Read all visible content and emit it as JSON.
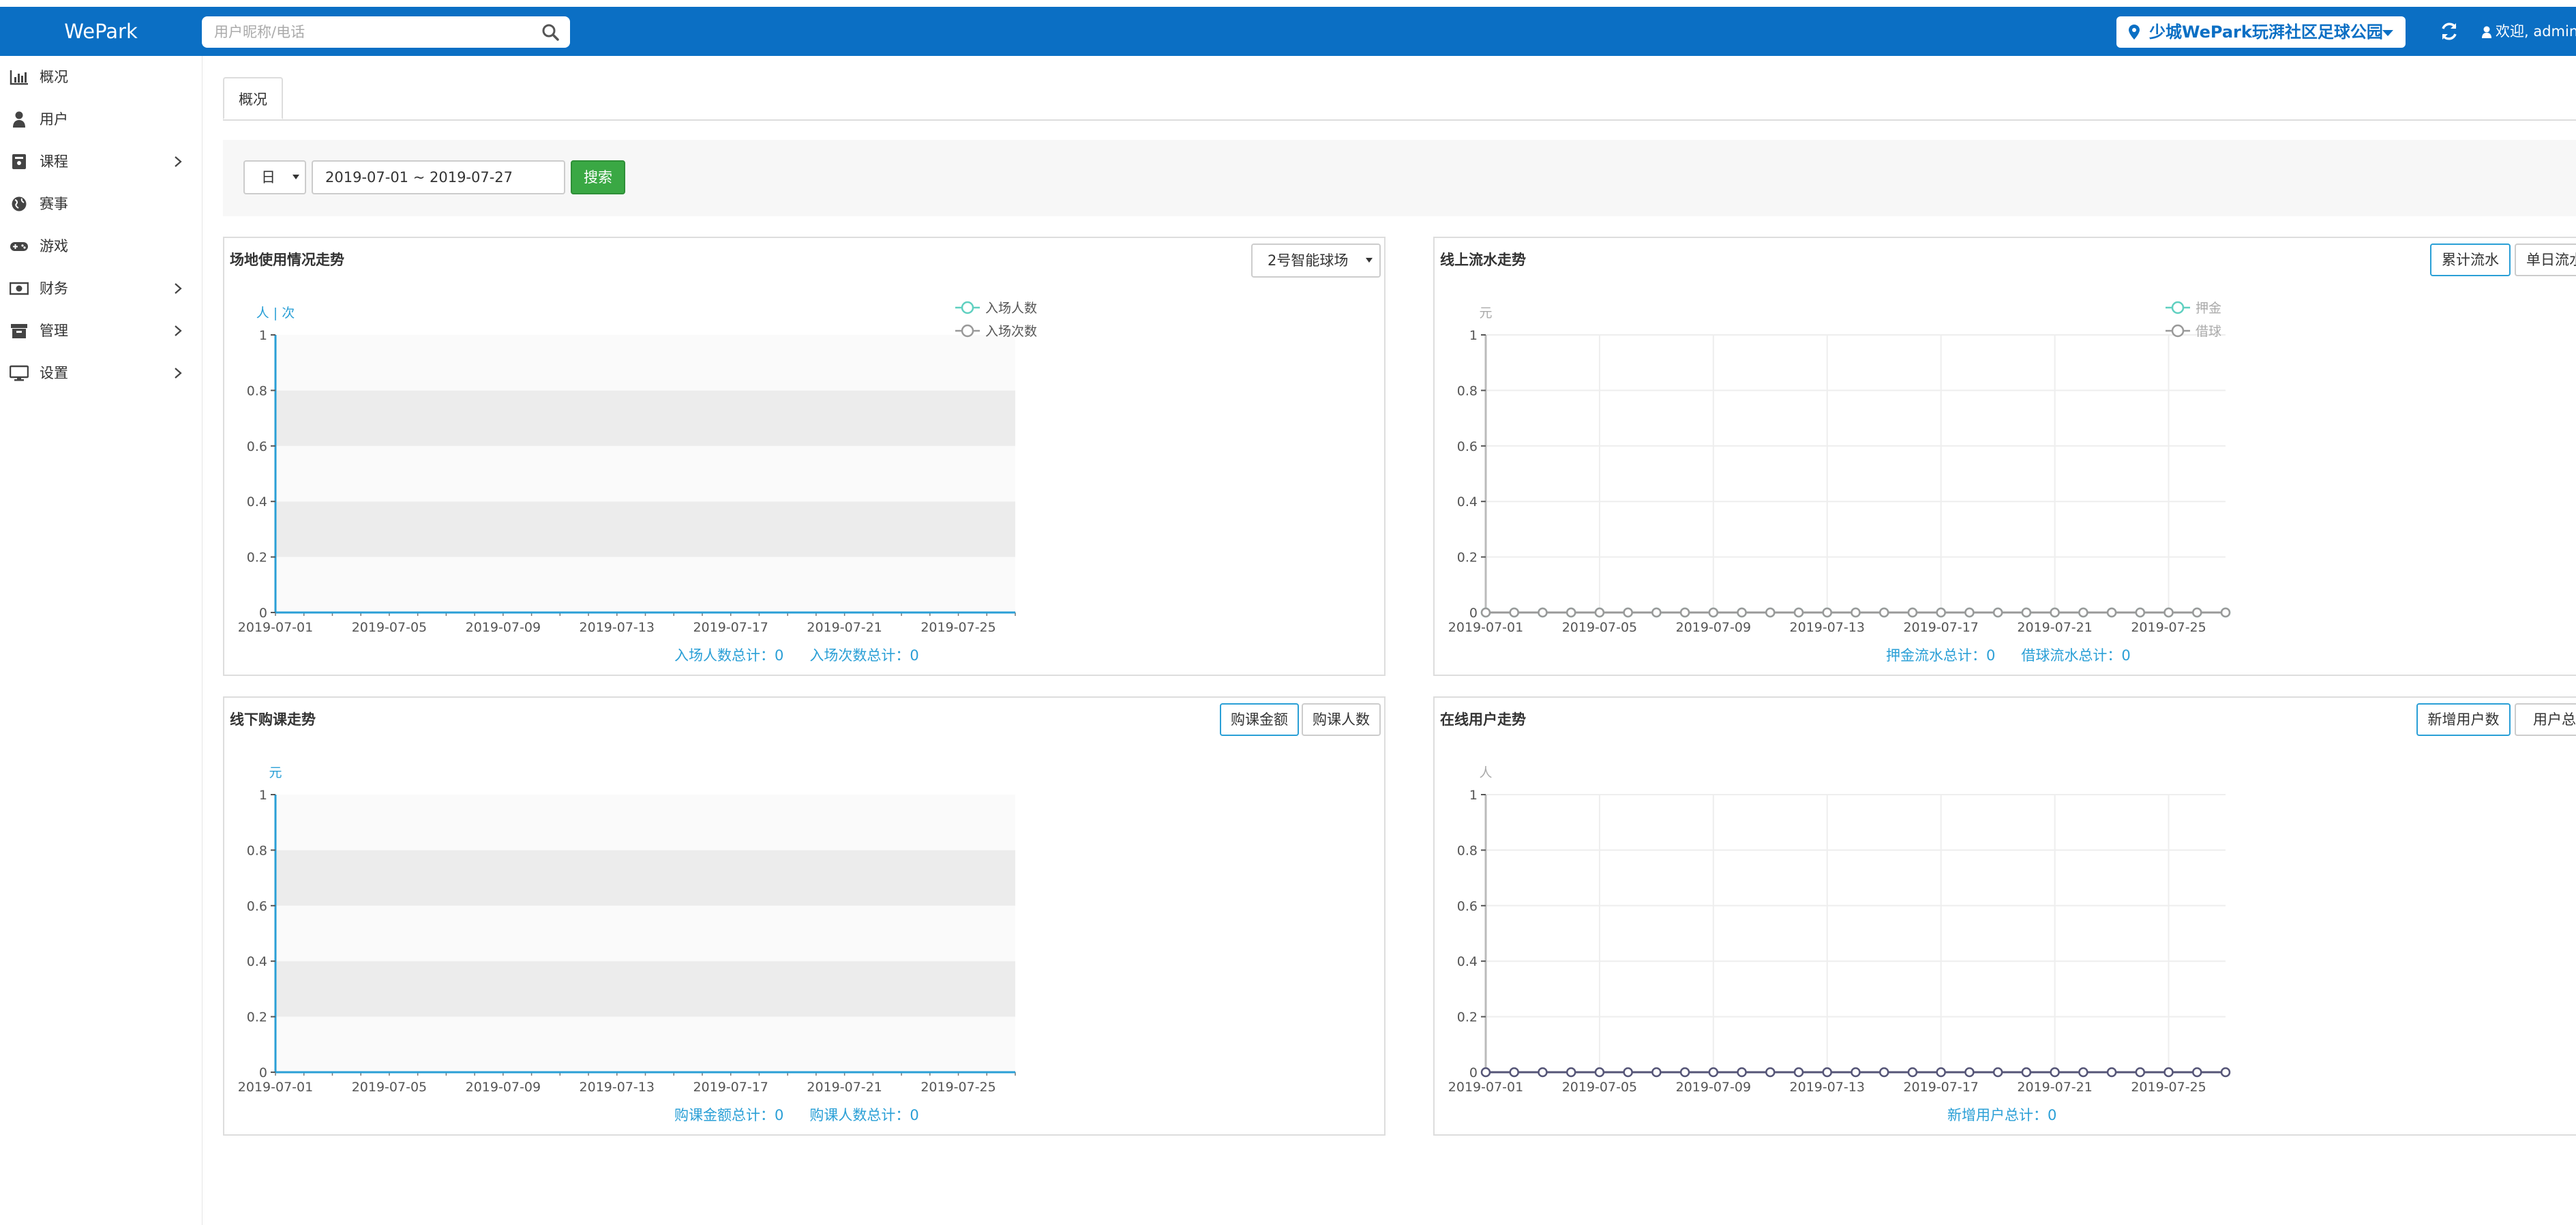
{
  "app": {
    "brand": "WePark"
  },
  "header": {
    "search_placeholder": "用户昵称/电话",
    "venue": "少城WePark玩湃社区足球公园",
    "welcome": "欢迎, admin"
  },
  "sidebar": {
    "items": [
      {
        "label": "概况",
        "icon": "bar-chart-icon",
        "has_submenu": false
      },
      {
        "label": "用户",
        "icon": "user-icon",
        "has_submenu": false
      },
      {
        "label": "课程",
        "icon": "book-icon",
        "has_submenu": true
      },
      {
        "label": "赛事",
        "icon": "globe-icon",
        "has_submenu": false
      },
      {
        "label": "游戏",
        "icon": "gamepad-icon",
        "has_submenu": false
      },
      {
        "label": "财务",
        "icon": "money-icon",
        "has_submenu": true
      },
      {
        "label": "管理",
        "icon": "archive-icon",
        "has_submenu": true
      },
      {
        "label": "设置",
        "icon": "desktop-icon",
        "has_submenu": true
      }
    ]
  },
  "tabs": [
    {
      "label": "概况",
      "active": true
    }
  ],
  "filter": {
    "period": "日",
    "date_range": "2019-07-01 ~ 2019-07-27",
    "search_label": "搜索"
  },
  "colors": {
    "navbar": "#0b6fc4",
    "accent": "#2a9fd6",
    "search_button": "#3aa844",
    "series_teal": "#5fd0c0",
    "series_gray": "#999999",
    "series_dark": "#555577"
  },
  "panels": {
    "venue_usage": {
      "title": "场地使用情况走势",
      "select_value": "2号智能球场",
      "totals": [
        "入场人数总计：0",
        "入场次数总计：0"
      ]
    },
    "online_flow": {
      "title": "线上流水走势",
      "buttons": [
        "累计流水",
        "单日流水"
      ],
      "totals": [
        "押金流水总计：0",
        "借球流水总计：0"
      ]
    },
    "offline_purchase": {
      "title": "线下购课走势",
      "buttons": [
        "购课金额",
        "购课人数"
      ],
      "totals": [
        "购课金额总计：0",
        "购课人数总计：0"
      ]
    },
    "online_users": {
      "title": "在线用户走势",
      "buttons": [
        "新增用户数",
        "用户总数"
      ],
      "totals": [
        "新增用户总计：0"
      ]
    }
  },
  "chart_data": [
    {
      "id": "venue_usage",
      "type": "line",
      "style": "banded",
      "ylabel": "人 | 次",
      "ylim": [
        0,
        1
      ],
      "yticks": [
        "0",
        "0.2",
        "0.4",
        "0.6",
        "0.8",
        "1"
      ],
      "xticks": [
        "2019-07-01",
        "2019-07-05",
        "2019-07-09",
        "2019-07-13",
        "2019-07-17",
        "2019-07-21",
        "2019-07-25"
      ],
      "legend": [
        "入场人数",
        "入场次数"
      ],
      "legend_position": "top-right",
      "x": [
        "2019-07-01",
        "2019-07-02",
        "2019-07-03",
        "2019-07-04",
        "2019-07-05",
        "2019-07-06",
        "2019-07-07",
        "2019-07-08",
        "2019-07-09",
        "2019-07-10",
        "2019-07-11",
        "2019-07-12",
        "2019-07-13",
        "2019-07-14",
        "2019-07-15",
        "2019-07-16",
        "2019-07-17",
        "2019-07-18",
        "2019-07-19",
        "2019-07-20",
        "2019-07-21",
        "2019-07-22",
        "2019-07-23",
        "2019-07-24",
        "2019-07-25",
        "2019-07-26",
        "2019-07-27"
      ],
      "series": [
        {
          "name": "入场人数",
          "values": [
            0,
            0,
            0,
            0,
            0,
            0,
            0,
            0,
            0,
            0,
            0,
            0,
            0,
            0,
            0,
            0,
            0,
            0,
            0,
            0,
            0,
            0,
            0,
            0,
            0,
            0,
            0
          ],
          "markers": false
        },
        {
          "name": "入场次数",
          "values": [
            0,
            0,
            0,
            0,
            0,
            0,
            0,
            0,
            0,
            0,
            0,
            0,
            0,
            0,
            0,
            0,
            0,
            0,
            0,
            0,
            0,
            0,
            0,
            0,
            0,
            0,
            0
          ],
          "markers": false
        }
      ]
    },
    {
      "id": "online_flow",
      "type": "line",
      "style": "grid",
      "ylabel": "元",
      "ylim": [
        0,
        1
      ],
      "yticks": [
        "0",
        "0.2",
        "0.4",
        "0.6",
        "0.8",
        "1"
      ],
      "xticks": [
        "2019-07-01",
        "2019-07-05",
        "2019-07-09",
        "2019-07-13",
        "2019-07-17",
        "2019-07-21",
        "2019-07-25"
      ],
      "legend": [
        "押金",
        "借球"
      ],
      "legend_position": "top-right",
      "x": [
        "2019-07-01",
        "2019-07-02",
        "2019-07-03",
        "2019-07-04",
        "2019-07-05",
        "2019-07-06",
        "2019-07-07",
        "2019-07-08",
        "2019-07-09",
        "2019-07-10",
        "2019-07-11",
        "2019-07-12",
        "2019-07-13",
        "2019-07-14",
        "2019-07-15",
        "2019-07-16",
        "2019-07-17",
        "2019-07-18",
        "2019-07-19",
        "2019-07-20",
        "2019-07-21",
        "2019-07-22",
        "2019-07-23",
        "2019-07-24",
        "2019-07-25",
        "2019-07-26",
        "2019-07-27"
      ],
      "series": [
        {
          "name": "押金",
          "values": [
            0,
            0,
            0,
            0,
            0,
            0,
            0,
            0,
            0,
            0,
            0,
            0,
            0,
            0,
            0,
            0,
            0,
            0,
            0,
            0,
            0,
            0,
            0,
            0,
            0,
            0,
            0
          ],
          "markers": true
        },
        {
          "name": "借球",
          "values": [
            0,
            0,
            0,
            0,
            0,
            0,
            0,
            0,
            0,
            0,
            0,
            0,
            0,
            0,
            0,
            0,
            0,
            0,
            0,
            0,
            0,
            0,
            0,
            0,
            0,
            0,
            0
          ],
          "markers": true
        }
      ]
    },
    {
      "id": "offline_purchase",
      "type": "line",
      "style": "banded",
      "ylabel": "元",
      "ylim": [
        0,
        1
      ],
      "yticks": [
        "0",
        "0.2",
        "0.4",
        "0.6",
        "0.8",
        "1"
      ],
      "xticks": [
        "2019-07-01",
        "2019-07-05",
        "2019-07-09",
        "2019-07-13",
        "2019-07-17",
        "2019-07-21",
        "2019-07-25"
      ],
      "legend": [],
      "x": [
        "2019-07-01",
        "2019-07-02",
        "2019-07-03",
        "2019-07-04",
        "2019-07-05",
        "2019-07-06",
        "2019-07-07",
        "2019-07-08",
        "2019-07-09",
        "2019-07-10",
        "2019-07-11",
        "2019-07-12",
        "2019-07-13",
        "2019-07-14",
        "2019-07-15",
        "2019-07-16",
        "2019-07-17",
        "2019-07-18",
        "2019-07-19",
        "2019-07-20",
        "2019-07-21",
        "2019-07-22",
        "2019-07-23",
        "2019-07-24",
        "2019-07-25",
        "2019-07-26",
        "2019-07-27"
      ],
      "series": [
        {
          "values": [
            0,
            0,
            0,
            0,
            0,
            0,
            0,
            0,
            0,
            0,
            0,
            0,
            0,
            0,
            0,
            0,
            0,
            0,
            0,
            0,
            0,
            0,
            0,
            0,
            0,
            0,
            0
          ],
          "markers": false
        }
      ]
    },
    {
      "id": "online_users",
      "type": "line",
      "style": "grid",
      "ylabel": "人",
      "ylim": [
        0,
        1
      ],
      "yticks": [
        "0",
        "0.2",
        "0.4",
        "0.6",
        "0.8",
        "1"
      ],
      "xticks": [
        "2019-07-01",
        "2019-07-05",
        "2019-07-09",
        "2019-07-13",
        "2019-07-17",
        "2019-07-21",
        "2019-07-25"
      ],
      "legend": [],
      "x": [
        "2019-07-01",
        "2019-07-02",
        "2019-07-03",
        "2019-07-04",
        "2019-07-05",
        "2019-07-06",
        "2019-07-07",
        "2019-07-08",
        "2019-07-09",
        "2019-07-10",
        "2019-07-11",
        "2019-07-12",
        "2019-07-13",
        "2019-07-14",
        "2019-07-15",
        "2019-07-16",
        "2019-07-17",
        "2019-07-18",
        "2019-07-19",
        "2019-07-20",
        "2019-07-21",
        "2019-07-22",
        "2019-07-23",
        "2019-07-24",
        "2019-07-25",
        "2019-07-26",
        "2019-07-27"
      ],
      "series": [
        {
          "values": [
            0,
            0,
            0,
            0,
            0,
            0,
            0,
            0,
            0,
            0,
            0,
            0,
            0,
            0,
            0,
            0,
            0,
            0,
            0,
            0,
            0,
            0,
            0,
            0,
            0,
            0,
            0
          ],
          "markers": true
        }
      ]
    }
  ]
}
